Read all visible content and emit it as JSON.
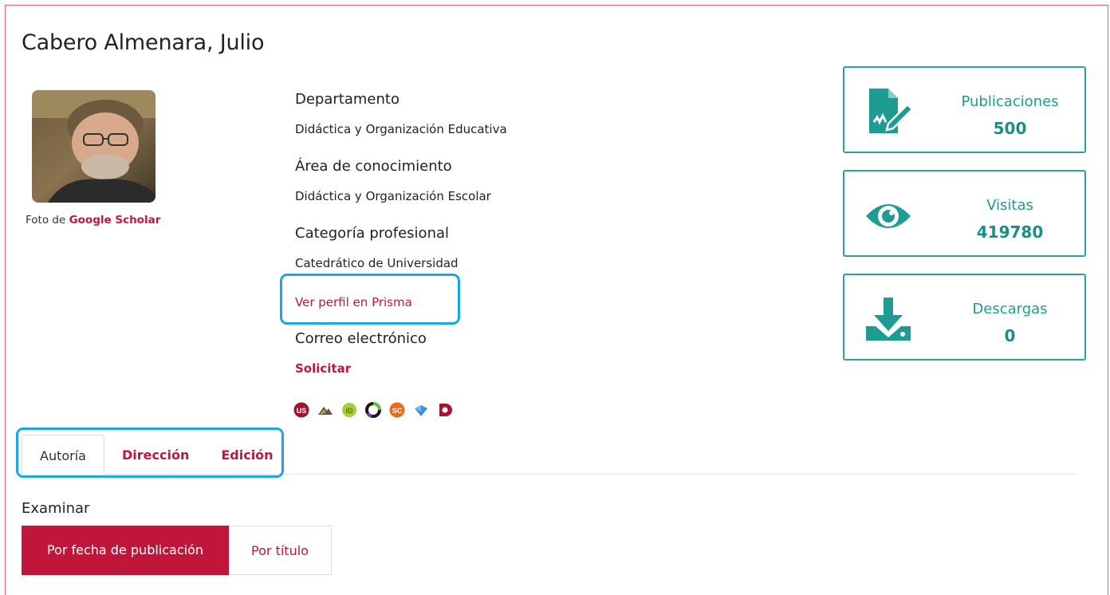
{
  "profile": {
    "name": "Cabero Almenara, Julio",
    "photo_caption_prefix": "Foto de",
    "photo_caption_link": "Google Scholar"
  },
  "info": {
    "department_label": "Departamento",
    "department_value": "Didáctica y Organización Educativa",
    "area_label": "Área de conocimiento",
    "area_value": "Didáctica y Organización Escolar",
    "category_label": "Categoría profesional",
    "category_value": "Catedrático de Universidad",
    "prisma_link": "Ver perfil en Prisma",
    "email_label": "Correo electrónico",
    "email_link": "Solicitar"
  },
  "external_icons": [
    {
      "name": "us-icon",
      "color": "#a3112f",
      "text": "US"
    },
    {
      "name": "mountain-icon",
      "color": "#555555"
    },
    {
      "name": "orcid-icon",
      "color": "#8fbf3a",
      "text": "iD"
    },
    {
      "name": "dialnet-icon",
      "color": "#333333"
    },
    {
      "name": "scholar-icon",
      "color": "#ea6a1c",
      "text": "SC"
    },
    {
      "name": "researchgate-icon",
      "color": "#3a8fd8"
    },
    {
      "name": "dspace-icon",
      "color": "#b0102f"
    }
  ],
  "stats": [
    {
      "label": "Publicaciones",
      "value": "500",
      "icon": "publication-icon"
    },
    {
      "label": "Visitas",
      "value": "419780",
      "icon": "eye-icon"
    },
    {
      "label": "Descargas",
      "value": "0",
      "icon": "download-icon"
    }
  ],
  "tabs": [
    {
      "label": "Autoría",
      "active": true
    },
    {
      "label": "Dirección",
      "active": false
    },
    {
      "label": "Edición",
      "active": false
    }
  ],
  "browse": {
    "label": "Examinar",
    "by_date": "Por fecha de publicación",
    "by_title": "Por título"
  },
  "colors": {
    "accent": "#c0163c",
    "teal": "#1d9c92",
    "highlight": "#1aa6e8"
  }
}
